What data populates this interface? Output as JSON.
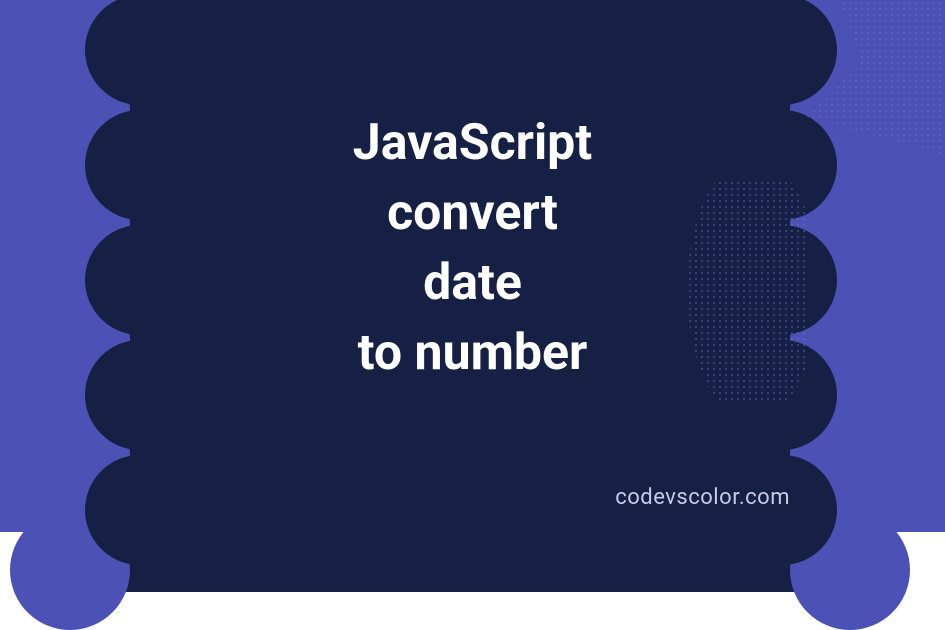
{
  "headline": {
    "line1": "JavaScript",
    "line2": "convert",
    "line3": "date",
    "line4": "to number"
  },
  "credit": "codevscolor.com",
  "colors": {
    "background": "#4c52b5",
    "blob": "#152044",
    "text": "#ffffff",
    "credit": "#c9cbe6"
  }
}
